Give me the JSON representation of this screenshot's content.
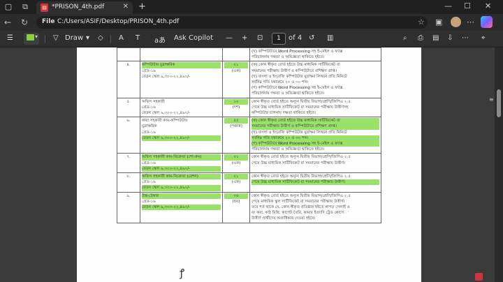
{
  "browser": {
    "tab_title": "*PRISON_4th.pdf",
    "address_label": "File",
    "url": "C:/Users/ASIF/Desktop/PRISON_4th.pdf"
  },
  "toolbar": {
    "draw_label": "Draw",
    "ask_copilot_label": "Ask Copilot",
    "page_number": "1",
    "page_total": "of 4",
    "highlight_color": "#8bd33e"
  },
  "table": {
    "rows": [
      {
        "sn": "",
        "post": [],
        "num": [],
        "quals": [
          "(খ) কম্পিউটারে Word Processing সহ ই-মেইল ও ফ্যাক্স",
          "পরিচালনায় দক্ষতা ও অভিজ্ঞতা থাকিতে হইবে।"
        ]
      },
      {
        "sn": "৪.",
        "post": [
          "কম্পিউটার মুদ্রাক্ষরিক",
          "গ্রেড-১৬",
          "বেতন স্কেল ৯,৩০০-২২,৪৯০/-"
        ],
        "num": [
          "০১",
          "(এক)"
        ],
        "quals": [
          "(ক) কোন স্বীকৃত বোর্ড হইতে উচ্চ মাধ্যমিক সার্টিফিকেট বা",
          "সমমানের পরীক্ষায় উত্তীর্ণ ও কম্পিউটারে প্রশিক্ষণ প্রাপ্ত।",
          "(খ) বাংলা ও ইংরেজি কম্পিউটার মুদ্রাক্ষর লিখনে প্রতি মিনিটে",
          "সর্বনিম্ন গতি যথাক্রমে ২০ ও ৩০ শব্দ।",
          "(গ) কম্পিউটারে Word Processing সহ ই-মেইল ও ফ্যাক্স",
          "পরিচালনায় দক্ষতা ও অভিজ্ঞতা থাকিতে হইবে।"
        ]
      },
      {
        "sn": "৫.",
        "post": [
          "অফিস সহকারী",
          "গ্রেড-১৬",
          "বেতন স্কেল ৯,৩০০-২২,৪৯০/-"
        ],
        "num": [
          "১০",
          "(দশ)"
        ],
        "quals": [
          "কোন স্বীকৃত বোর্ড হইতে অন্যূন দ্বিতীয় বিভাগ/শ্রেণি/জিপিএ ২.৫",
          "পেয়ে উচ্চ মাধ্যমিক সার্টিফিকেট বা সমমানের পরীক্ষায় উত্তীর্ণসহ",
          "কম্পিউটার চালনায় দক্ষতা থাকিতে হইবে।"
        ]
      },
      {
        "sn": "৬.",
        "post": [
          "কারা সহকারী কাম-কম্পিউটার",
          "মুদ্রাক্ষরিক",
          "গ্রেড-১৬",
          "বেতন স্কেল ৯,৩০০-২২,৪৯০/-"
        ],
        "num": [
          "৫৫",
          "(পঞ্চান্ন)"
        ],
        "quals": [
          "(ক) কোন স্বীকৃত বোর্ড হইতে উচ্চ মাধ্যমিক সার্টিফিকেট বা",
          "সমমানের পরীক্ষায় উত্তীর্ণ ও কম্পিউটারে প্রশিক্ষণ প্রাপ্ত।",
          "(খ) বাংলা ও ইংরেজি কম্পিউটার মুদ্রাক্ষর লিখনে প্রতি মিনিটে",
          "সর্বনিম্ন গতি যথাক্রমে ২০ ও ৩০ শব্দ।",
          "(গ) কম্পিউটারে Word Processing সহ ই-মেইল ও ফ্যাক্স",
          "পরিচালনায় দক্ষতা ও অভিজ্ঞতা থাকিতে হইবে।"
        ]
      },
      {
        "sn": "৭.",
        "post": [
          "অফিস সহকারী কাম-বিক্রেতা (শো-রুম)",
          "গ্রেড-১৬",
          "বেতন স্কেল ৯,৩০০-২২,৪৯০/-"
        ],
        "num": [
          "০১",
          "(এক)"
        ],
        "quals": [
          "কোন স্বীকৃত বোর্ড হইতে অন্যূন দ্বিতীয় বিভাগ/শ্রেণি/জিপিএ ২.৫",
          "পেয়ে উচ্চ মাধ্যমিক সার্টিফিকেট বা সমমানের পরীক্ষায় উত্তীর্ণ।"
        ]
      },
      {
        "sn": "৮.",
        "post": [
          "অফিস সহকারী কাম-বিক্রেতা (রেশন)",
          "গ্রেড-১৬",
          "বেতন স্কেল ৯,৩০০-২২,৪৯০/-"
        ],
        "num": [
          "০১",
          "(এক)"
        ],
        "quals": [
          "কোন স্বীকৃত বোর্ড হইতে অন্যূন দ্বিতীয় বিভাগ/শ্রেণি/জিপিএ ২.৫",
          "পেয়ে উচ্চ মাধ্যমিক সার্টিফিকেট বা সমমানের পরীক্ষায় উত্তীর্ণ।"
        ]
      },
      {
        "sn": "৯.",
        "post": [
          "টাঙ্ক-টেকার",
          "গ্রেড-১৬",
          "বেতন স্কেল ৯,৩০০-২২,৪৯০/-"
        ],
        "num": [
          "০৬",
          "(ছয়)"
        ],
        "quals": [
          "কোন স্বীকৃত বোর্ড হইতে অন্যূন দ্বিতীয় বিভাগ/শ্রেণি/জিপিএ ২.৫",
          "পেয়ে মাধ্যমিক স্কুল সার্টিফিকেট বা সমমানের পরীক্ষায় উত্তীর্ণ।",
          "তবে শর্ত থাকে যে, কোন স্বীকৃত প্রতিষ্ঠান হইতে কাপড় সেলাই ও",
          "রং করা, কাঠ মিস্ত্রি, কাপেট তৈরি, কামার ইত্যাদি ট্রেড কোর্সে",
          "উত্তীর্ণ প্রার্থীদের অগ্রাধিকার দেওয়া হইবে।"
        ]
      }
    ]
  }
}
